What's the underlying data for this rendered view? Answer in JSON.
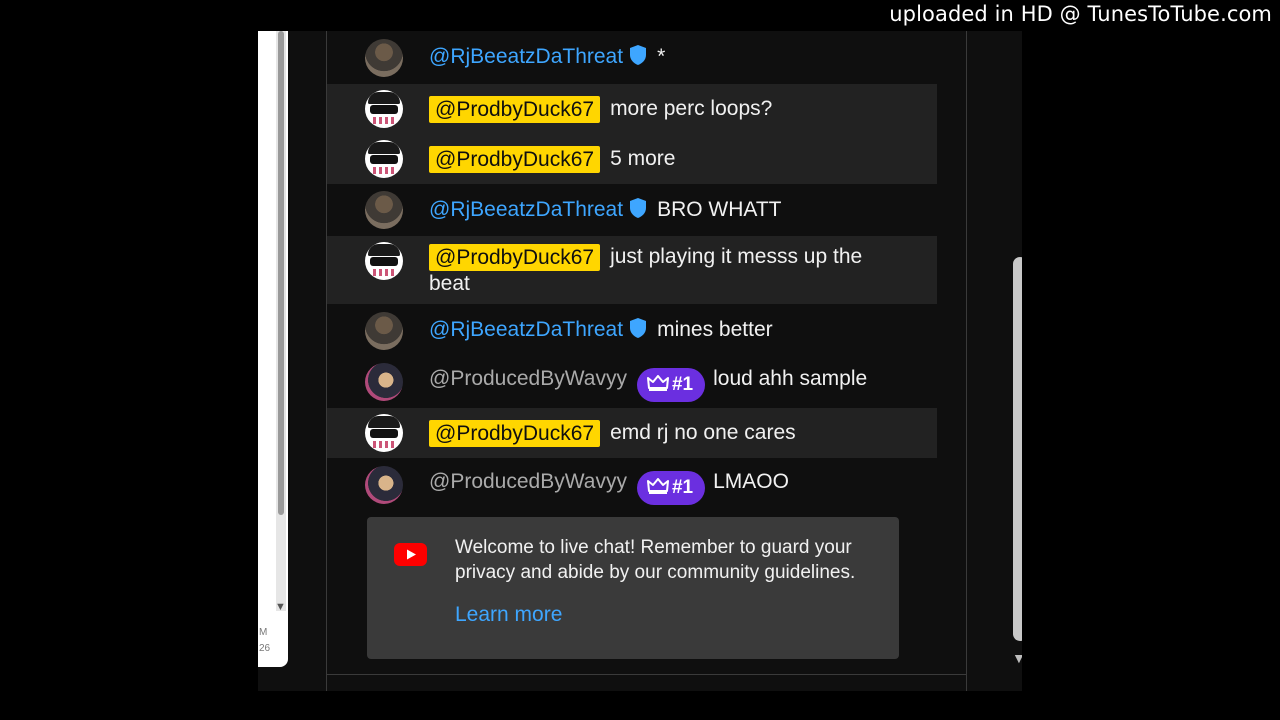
{
  "watermark": "uploaded in HD @ TunesToTube.com",
  "left_strip": {
    "frag1": "M",
    "frag2": "26"
  },
  "messages": [
    {
      "author": "@RjBeeatzDaThreat",
      "style": "blue",
      "verified": true,
      "text": "*"
    },
    {
      "author": "@ProdbyDuck67",
      "style": "owner",
      "text": "more perc loops?"
    },
    {
      "author": "@ProdbyDuck67",
      "style": "owner",
      "text": "5 more"
    },
    {
      "author": "@RjBeeatzDaThreat",
      "style": "blue",
      "verified": true,
      "text": "BRO WHATT"
    },
    {
      "author": "@ProdbyDuck67",
      "style": "owner",
      "text": "just playing it messs up the beat"
    },
    {
      "author": "@RjBeeatzDaThreat",
      "style": "blue",
      "verified": true,
      "text": "mines better"
    },
    {
      "author": "@ProducedByWavyy",
      "style": "grey",
      "badge": "#1",
      "text": "loud ahh sample"
    },
    {
      "author": "@ProdbyDuck67",
      "style": "owner",
      "text": "emd rj no one cares"
    },
    {
      "author": "@ProducedByWavyy",
      "style": "grey",
      "badge": "#1",
      "text": "LMAOO"
    }
  ],
  "welcome": {
    "text": "Welcome to live chat! Remember to guard your privacy and abide by our community guidelines.",
    "learn_more": "Learn more"
  },
  "colors": {
    "background": "#0f0f0f",
    "highlight_row": "#222222",
    "owner_badge": "#ffd600",
    "verified_blue": "#3ea6ff",
    "member_badge": "#6b2fe0",
    "youtube_red": "#ff0000"
  },
  "icons": [
    "verified-shield-icon",
    "crown-icon",
    "youtube-logo-icon",
    "chevron-down-icon"
  ]
}
